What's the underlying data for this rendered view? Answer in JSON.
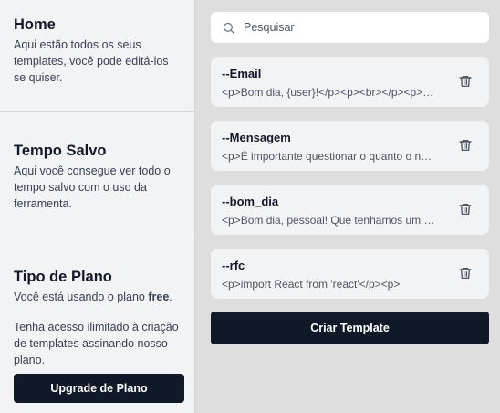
{
  "sidebar": {
    "home": {
      "title": "Home",
      "description": "Aqui estão todos os seus templates, você pode editá-los se quiser."
    },
    "saved_time": {
      "title": "Tempo Salvo",
      "description": "Aqui você consegue ver todo o tempo salvo com o uso da ferramenta."
    },
    "plan": {
      "title": "Tipo de Plano",
      "description_prefix": "Você está usando o plano ",
      "plan_name": "free",
      "description_suffix": ".",
      "extra": "Tenha acesso ilimitado à criação de templates assinando nosso plano.",
      "upgrade_label": "Upgrade de Plano"
    }
  },
  "search": {
    "placeholder": "Pesquisar",
    "icon": "search-icon"
  },
  "templates": [
    {
      "title": "--Email",
      "body": "<p>Bom dia, {user}!</p><p><br></p><p>Segue em anexo..."
    },
    {
      "title": "--Mensagem",
      "body": "<p>É importante questionar o quanto o novo modelo..."
    },
    {
      "title": "--bom_dia",
      "body": "<p>Bom dia, pessoal! Que tenhamos um ótimo dia...</p>"
    },
    {
      "title": "--rfc",
      "body": "<p>import React from 'react'</p><p>"
    }
  ],
  "create_label": "Criar Template",
  "colors": {
    "primary": "#111827",
    "background": "#dedede",
    "panel": "#f2f3f5"
  }
}
